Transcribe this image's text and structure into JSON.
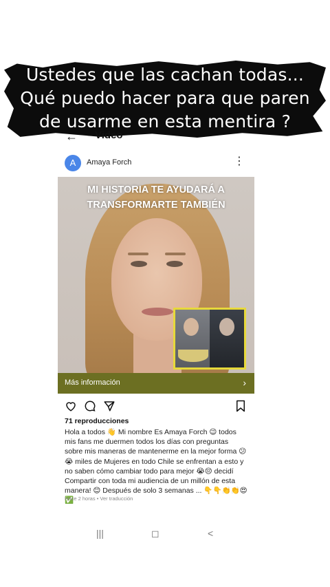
{
  "caption": {
    "lines": [
      "Ustedes que las cachan todas...",
      "Qué puedo hacer para que paren",
      "de usarme en esta mentira ?"
    ]
  },
  "topbar": {
    "back_icon": "arrow-left-icon",
    "title": "Video"
  },
  "post": {
    "avatar_letter": "A",
    "avatar_color": "#4a86e8",
    "username": "Amaya Forch",
    "more_icon": "more-vertical-icon",
    "media_overlay_text": [
      "MI HISTORIA TE AYUDARÁ A",
      "TRANSFORMARTE TAMBIÉN"
    ],
    "cta_label": "Más información",
    "cta_color": "#6c6f22",
    "views": "71 reproducciones",
    "description": "Hola a todos 👋 Mi nombre Es Amaya Forch 😉 todos mis fans me duermen todos los días con preguntas sobre mis maneras de mantenerme en la mejor forma 😕😭 miles de Mujeres en todo Chile se enfrentan a esto y no saben cómo cambiar todo para mejor 😭😔 decidí Compartir con toda mi audiencia de un millón de esta manera! 😊 Después de solo 3 semanas ... 👇👇👏👏😍✅",
    "meta": "Hace 2 horas • Ver traducción"
  },
  "navbar": {
    "recent": "|||",
    "home": "◻",
    "back": "<"
  }
}
